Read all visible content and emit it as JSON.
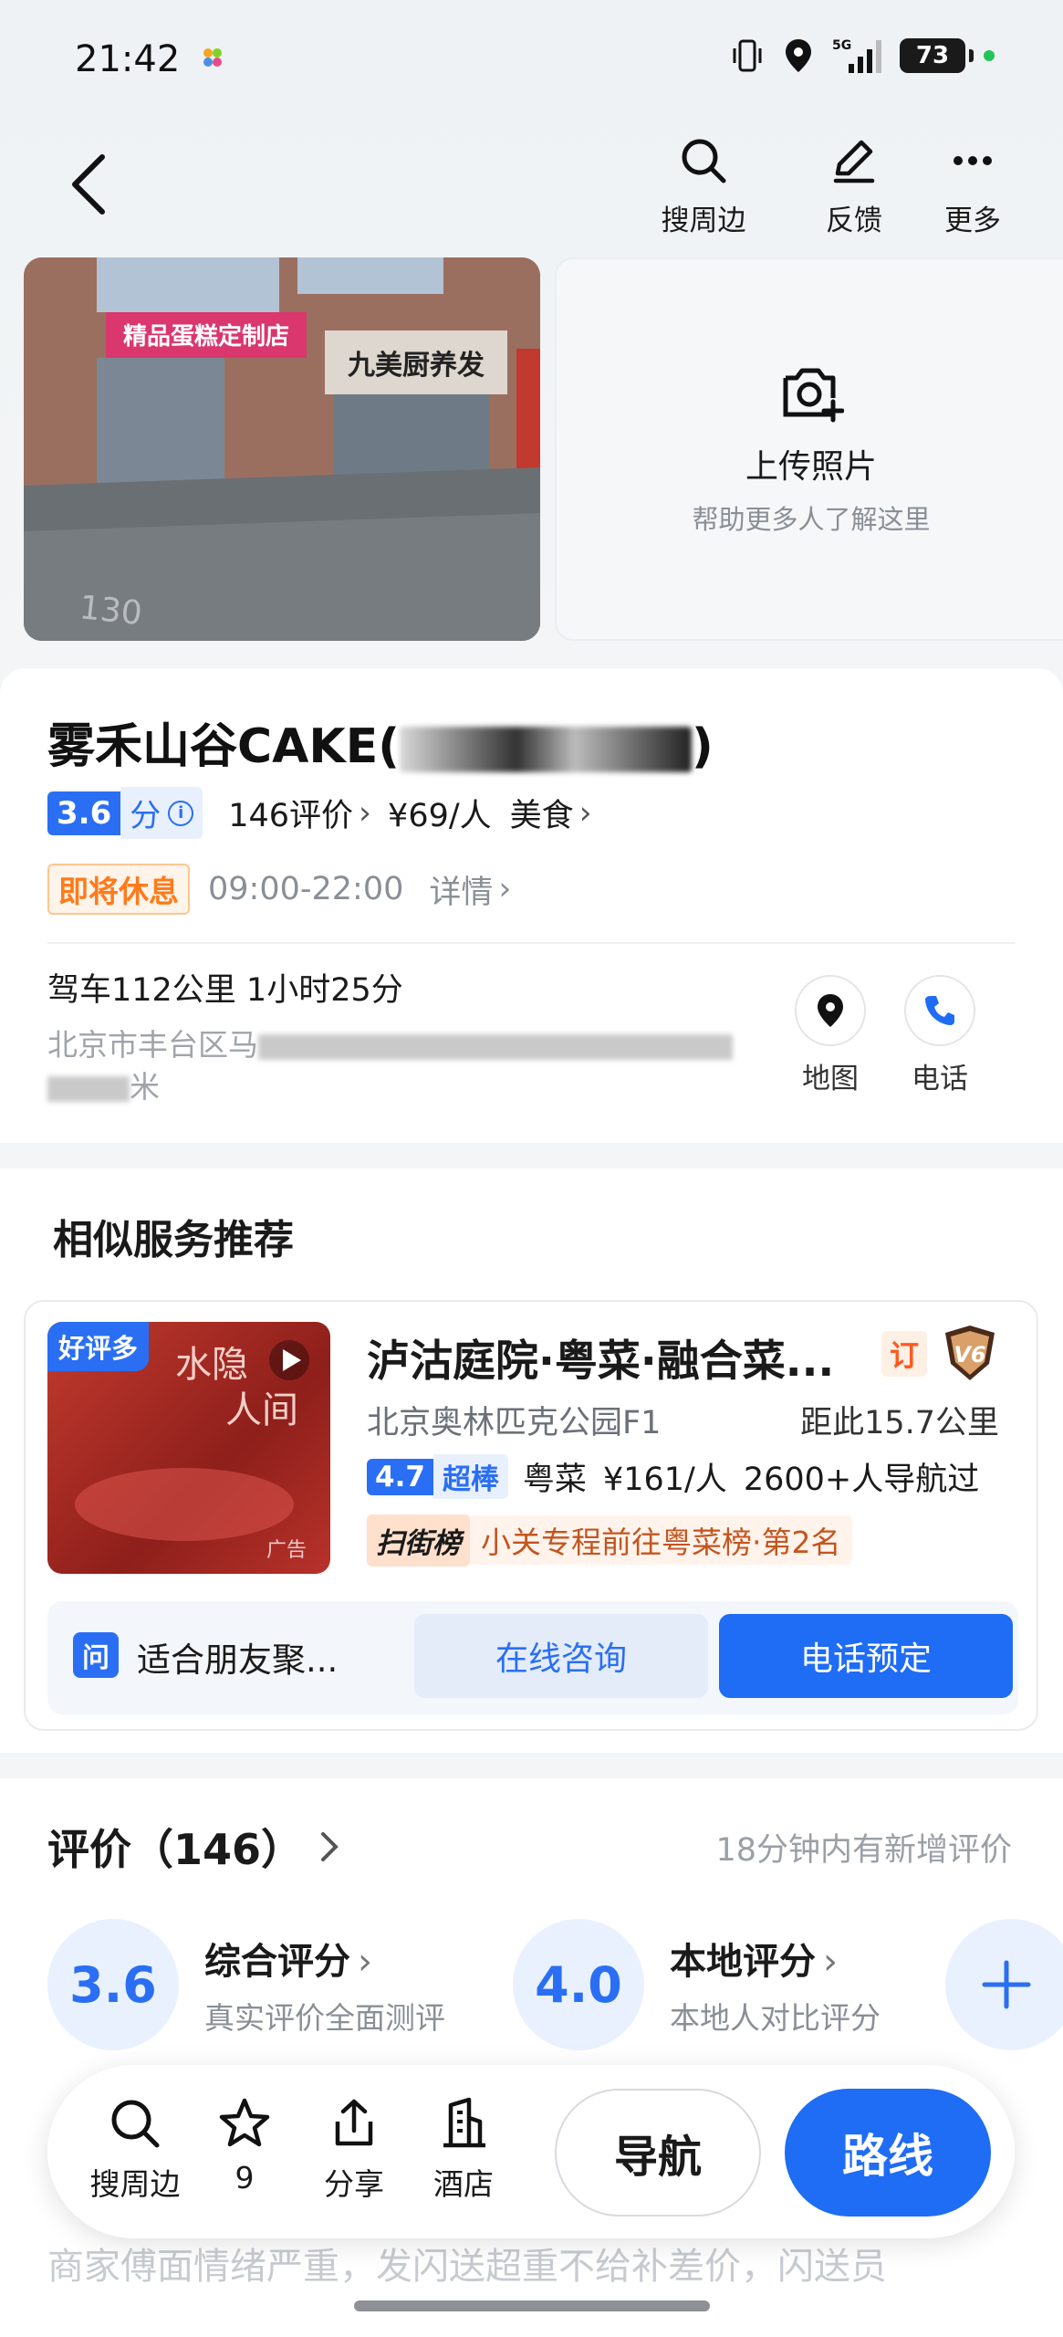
{
  "status_bar": {
    "time": "21:42",
    "battery": "73",
    "network": "5G"
  },
  "top_nav": {
    "actions": [
      {
        "label": "搜周边",
        "icon": "search-icon"
      },
      {
        "label": "反馈",
        "icon": "edit-icon"
      },
      {
        "label": "更多",
        "icon": "more-icon"
      }
    ]
  },
  "photos": {
    "main_sign_1": "精品蛋糕定制店",
    "main_sign_2": "九美厨养发",
    "ground_number": "130",
    "upload_title": "上传照片",
    "upload_subtitle": "帮助更多人了解这里"
  },
  "poi": {
    "name_prefix": "雾禾山谷CAKE(",
    "name_suffix": ")",
    "score": "3.6",
    "score_unit": "分",
    "reviews": "146评价",
    "price": "¥69/人",
    "category": "美食",
    "status_tag": "即将休息",
    "hours": "09:00-22:00",
    "details": "详情",
    "drive": "驾车112公里 1小时25分",
    "address_start": "北京市丰台区马",
    "address_end": "米",
    "map_label": "地图",
    "phone_label": "电话"
  },
  "similar": {
    "heading": "相似服务推荐",
    "item": {
      "tag": "好评多",
      "image_text_1": "水隐",
      "image_text_2": "人间",
      "ad": "广告",
      "name": "泸沽庭院·粤菜·融合菜...",
      "booking_tag": "订",
      "level_badge": "V6",
      "location": "北京奥林匹克公园F1",
      "distance": "距此15.7公里",
      "score": "4.7",
      "score_label": "超棒",
      "cuisine": "粤菜",
      "price": "¥161/人",
      "nav_count": "2600+人导航过",
      "rank_logo": "扫街榜",
      "rank_text": "小关专程前往粤菜榜·第2名",
      "question_icon": "问",
      "question": "适合朋友聚...",
      "consult_btn": "在线咨询",
      "book_btn": "电话预定"
    }
  },
  "reviews": {
    "heading": "评价（146）",
    "new_note": "18分钟内有新增评价",
    "overall": {
      "score": "3.6",
      "title": "综合评分",
      "subtitle": "真实评价全面测评"
    },
    "local": {
      "score": "4.0",
      "title": "本地评分",
      "subtitle": "本地人对比评分"
    },
    "snippet": "商家傅面情绪严重，发闪送超重不给补差价，闪送员"
  },
  "bottom_bar": {
    "search": "搜周边",
    "favorites": "9",
    "share": "分享",
    "hotel": "酒店",
    "navigate": "导航",
    "route": "路线"
  },
  "colors": {
    "accent": "#1f6cf5",
    "warning": "#ff7a1a"
  }
}
